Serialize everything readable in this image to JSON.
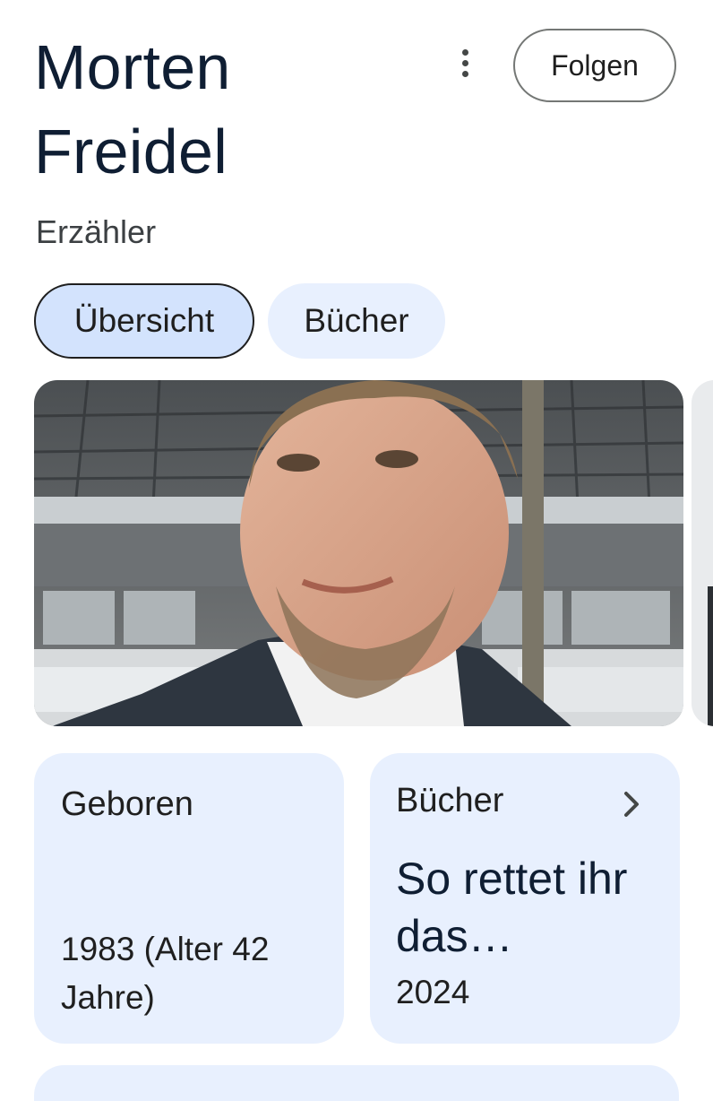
{
  "header": {
    "name": "Morten Freidel",
    "subtitle": "Erzähler",
    "follow_label": "Folgen",
    "more_icon": "more-vert-icon"
  },
  "tabs": [
    {
      "label": "Übersicht",
      "active": true
    },
    {
      "label": "Bücher",
      "active": false
    }
  ],
  "cards": {
    "born": {
      "label": "Geboren",
      "value": "1983 (Alter 42 Jahre)"
    },
    "books": {
      "label": "Bücher",
      "title": "So rettet ihr das…",
      "year": "2024",
      "icon": "chevron-right-icon"
    }
  },
  "colors": {
    "title": "#0f1e33",
    "chip_active_bg": "#d3e3fd",
    "card_bg": "#e8f0fe"
  }
}
